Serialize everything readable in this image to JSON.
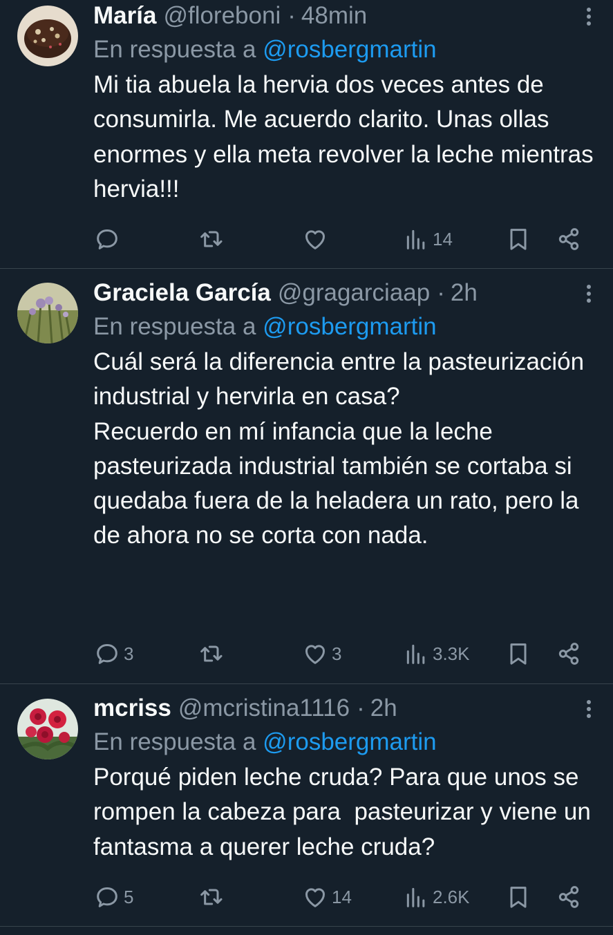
{
  "tweets": [
    {
      "name": "María",
      "handle": "@floreboni",
      "dot": "·",
      "time": "48min",
      "reply_prefix": "En respuesta a",
      "reply_mention": "@rosbergmartin",
      "paragraphs": [
        "Mi tia abuela la hervia dos veces antes de consumirla. Me acuerdo clarito. Unas ollas enormes y ella meta revolver la leche mientras hervia!!!"
      ],
      "replies": "",
      "retweets": "",
      "likes": "",
      "views": "14"
    },
    {
      "name": "Graciela García",
      "handle": "@gragarciaap",
      "dot": "·",
      "time": "2h",
      "reply_prefix": "En respuesta a",
      "reply_mention": "@rosbergmartin",
      "paragraphs": [
        "Cuál será la diferencia entre la pasteurización industrial y hervirla en casa?",
        "Recuerdo en mí infancia que la leche pasteurizada industrial también se cortaba si quedaba fuera de la heladera un rato, pero la de ahora no se corta con nada."
      ],
      "replies": "3",
      "retweets": "",
      "likes": "3",
      "views": "3.3K"
    },
    {
      "name": "mcriss",
      "handle": "@mcristina1116",
      "dot": "·",
      "time": "2h",
      "reply_prefix": "En respuesta a",
      "reply_mention": "@rosbergmartin",
      "paragraphs": [
        "Porqué piden leche cruda? Para que unos se rompen la cabeza para  pasteurizar y viene un fantasma a querer leche cruda?"
      ],
      "replies": "5",
      "retweets": "",
      "likes": "14",
      "views": "2.6K"
    }
  ],
  "icons": {
    "more": "more-vertical-icon",
    "reply": "reply-icon",
    "retweet": "retweet-icon",
    "like": "heart-icon",
    "views": "views-icon",
    "bookmark": "bookmark-icon",
    "share": "share-icon"
  },
  "colors": {
    "background": "#15202b",
    "text": "#f7f9f9",
    "secondary": "#8b98a5",
    "link": "#1d9bf0",
    "divider": "#38444d"
  }
}
